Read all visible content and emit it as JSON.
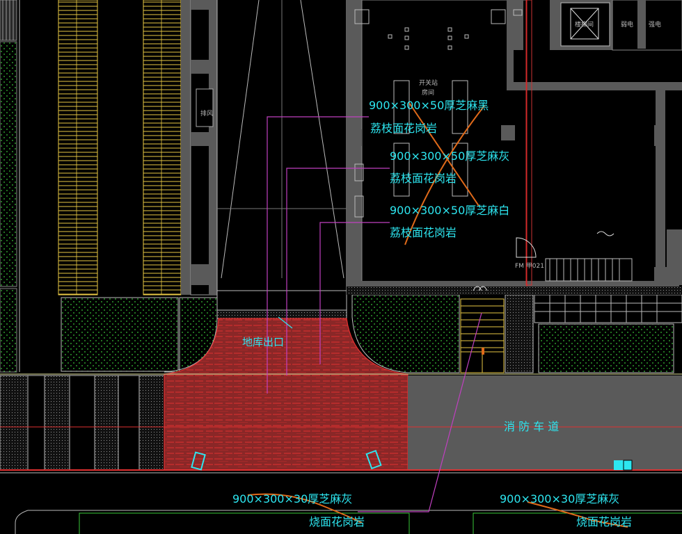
{
  "labels": {
    "spec_top_1a": "900×300×50厚芝麻黑",
    "spec_top_1b": "荔枝面花岗岩",
    "spec_top_2a": "900×300×50厚芝麻灰",
    "spec_top_2b": "荔枝面花岗岩",
    "spec_top_3a": "900×300×50厚芝麻白",
    "spec_top_3b": "荔枝面花岗岩",
    "garage_exit": "地库出口",
    "fire_lane": "消 防 车 道",
    "spec_bottom_left_a": "900×300×30厚芝麻灰",
    "spec_bottom_left_b": "烧面花岗岩",
    "spec_bottom_right_a": "900×300×30厚芝麻灰",
    "spec_bottom_right_b": "烧面花岗岩",
    "room_exhaust": "排风",
    "room_switch_a": "开关站",
    "room_switch_b": "房间",
    "room_stair": "楼梯间",
    "room_elec_1": "弱电",
    "room_elec_2": "强电",
    "door_tag": "FM 甲021"
  },
  "colors": {
    "background": "#000000",
    "label": "#2de6f0",
    "leader": "#c040c0",
    "paving": "#8a2727",
    "hatch": "#e03030",
    "gray_fill": "#5a5a5a",
    "lawn": "#1a2a1a",
    "yellow": "#e8c845",
    "orange": "#e06a1a"
  }
}
